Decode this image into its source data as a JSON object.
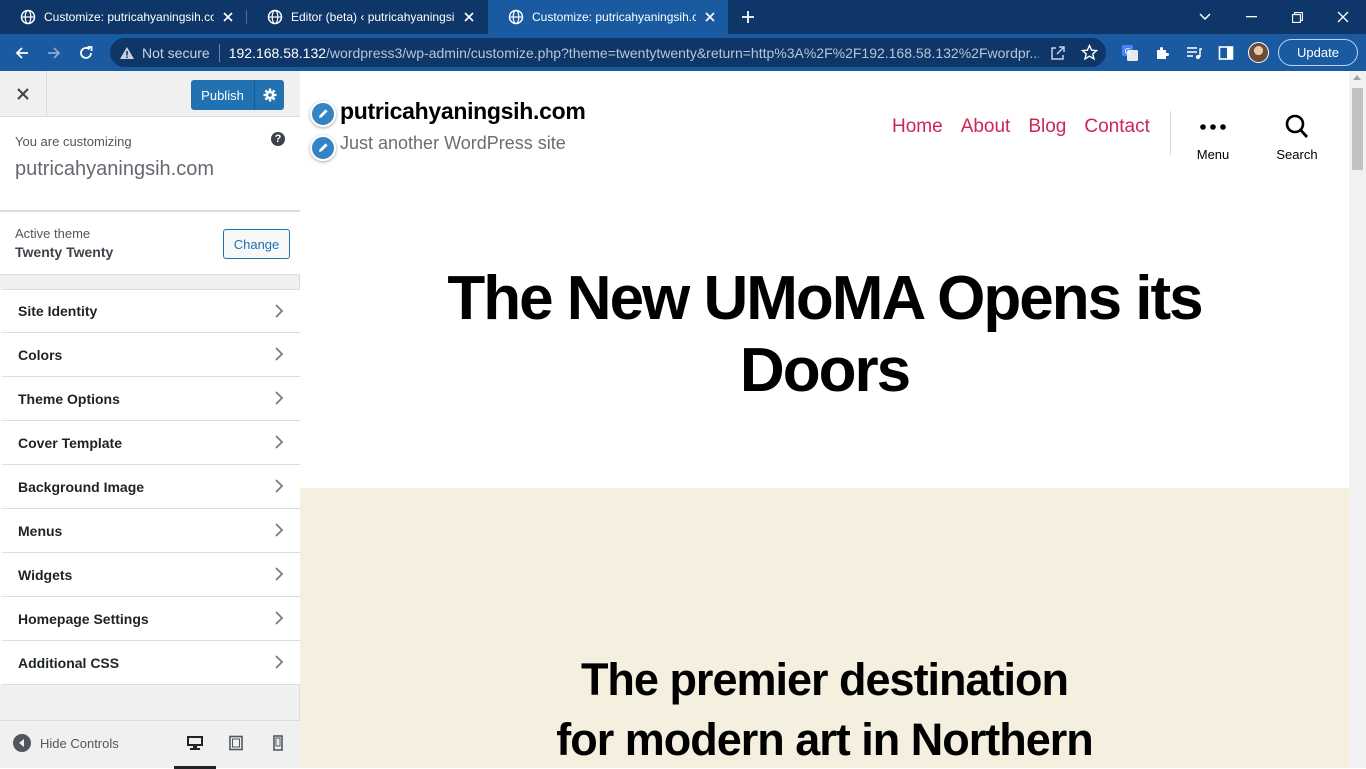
{
  "browser": {
    "tabs": [
      {
        "title": "Customize: putricahyaningsih.com",
        "active": false
      },
      {
        "title": "Editor (beta) ‹ putricahyaningsih.com",
        "active": false
      },
      {
        "title": "Customize: putricahyaningsih.com",
        "active": true
      }
    ],
    "security_label": "Not secure",
    "url_host": "192.168.58.132",
    "url_path": "/wordpress3/wp-admin/customize.php?theme=twentytwenty&return=http%3A%2F%2F192.168.58.132%2Fwordpr...",
    "update_label": "Update",
    "colors": {
      "frame": "#0e3668",
      "toolbar": "#1a5aa0"
    }
  },
  "customizer": {
    "publish_label": "Publish",
    "customizing_label": "You are customizing",
    "site_name": "putricahyaningsih.com",
    "help_icon": "?",
    "active_theme_label": "Active theme",
    "active_theme_name": "Twenty Twenty",
    "change_label": "Change",
    "sections": [
      {
        "label": "Site Identity"
      },
      {
        "label": "Colors"
      },
      {
        "label": "Theme Options"
      },
      {
        "label": "Cover Template"
      },
      {
        "label": "Background Image"
      },
      {
        "label": "Menus"
      },
      {
        "label": "Widgets"
      },
      {
        "label": "Homepage Settings"
      },
      {
        "label": "Additional CSS"
      }
    ],
    "hide_controls_label": "Hide Controls",
    "colors": {
      "primary": "#2271b1"
    }
  },
  "preview": {
    "site_title": "putricahyaningsih.com",
    "site_description": "Just another WordPress site",
    "nav": [
      "Home",
      "About",
      "Blog",
      "Contact"
    ],
    "menu_label": "Menu",
    "search_label": "Search",
    "headline_line1": "The New UMoMA Opens its",
    "headline_line2": "Doors",
    "cover_line1": "The premier destination",
    "cover_line2": "for modern art in Northern",
    "colors": {
      "accent": "#cd2653",
      "cover_bg": "#f5efe0"
    }
  }
}
